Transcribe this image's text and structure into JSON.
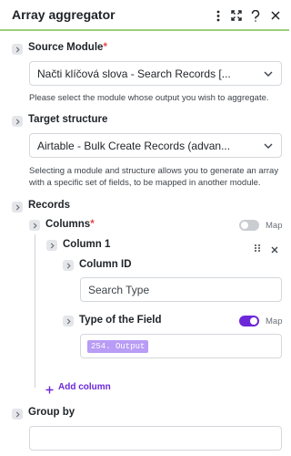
{
  "header": {
    "title": "Array aggregator",
    "icons": [
      "more-vertical-icon",
      "fullscreen-icon",
      "help-icon",
      "close-icon"
    ]
  },
  "source_module": {
    "label": "Source Module",
    "required_mark": "*",
    "value": "Načti klíčová slova - Search Records [...",
    "help": "Please select the module whose output you wish to aggregate."
  },
  "target_structure": {
    "label": "Target structure",
    "value": "Airtable - Bulk Create Records (advan...",
    "help": "Selecting a module and structure allows you to generate an array with a specific set of fields, to be mapped in another module."
  },
  "records": {
    "label": "Records",
    "columns": {
      "label": "Columns",
      "required_mark": "*",
      "map_label": "Map",
      "map_on": false,
      "column1": {
        "label": "Column 1",
        "column_id": {
          "label": "Column ID",
          "value": "Search Type"
        },
        "field_type": {
          "label": "Type of the Field",
          "map_label": "Map",
          "map_on": true,
          "pill": "254. Output"
        }
      },
      "add_column": "Add column"
    }
  },
  "group_by": {
    "label": "Group by",
    "value": ""
  },
  "colors": {
    "accent": "#6d28d9",
    "toggle_on": "#6d28d9",
    "toggle_off": "#c9ccd1",
    "header_rule": "#9bcf7a",
    "pill": "#b89cf5"
  }
}
